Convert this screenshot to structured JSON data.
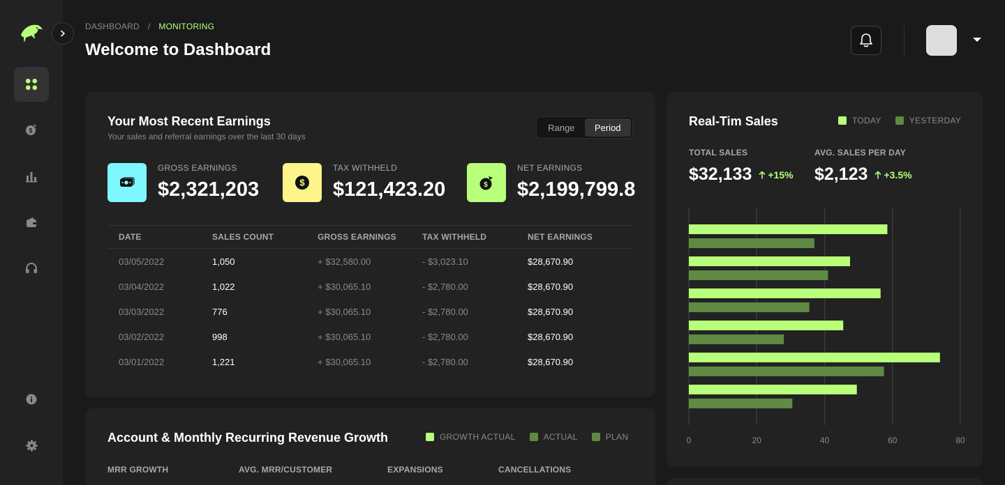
{
  "breadcrumb": {
    "root": "DASHBOARD",
    "separator": "/",
    "current": "MONITORING"
  },
  "page_title": "Welcome to Dashboard",
  "colors": {
    "accent": "#b8ff7a",
    "accent_dark": "#5f8a44",
    "cyan": "#7ff7ff",
    "yellow": "#fdf58a",
    "green": "#b8ff7a"
  },
  "sidebar": {
    "items": [
      {
        "icon": "dashboard-grid-icon",
        "active": true
      },
      {
        "icon": "money-bag-icon",
        "active": false
      },
      {
        "icon": "bar-chart-icon",
        "active": false
      },
      {
        "icon": "wallet-icon",
        "active": false
      },
      {
        "icon": "headphones-icon",
        "active": false
      },
      {
        "icon": "info-icon",
        "active": false
      },
      {
        "icon": "gear-icon",
        "active": false
      }
    ]
  },
  "earnings": {
    "title": "Your Most Recent Earnings",
    "subtitle": "Your sales and referral earnings over the last 30 days",
    "toggle": [
      "Range",
      "Period"
    ],
    "toggle_selected": "Period",
    "stats": [
      {
        "label": "GROSS EARNINGS",
        "value": "$2,321,203",
        "icon": "cash-icon"
      },
      {
        "label": "TAX WITHHELD",
        "value": "$121,423.20",
        "icon": "dollar-coin-icon"
      },
      {
        "label": "NET EARNINGS",
        "value": "$2,199,799.8",
        "icon": "money-bag-icon"
      }
    ],
    "table": {
      "headers": [
        "DATE",
        "SALES COUNT",
        "GROSS EARNINGS",
        "TAX WITHHELD",
        "NET EARNINGS"
      ],
      "rows": [
        [
          "03/05/2022",
          "1,050",
          "+ $32,580.00",
          "- $3,023.10",
          "$28,670.90"
        ],
        [
          "03/04/2022",
          "1,022",
          "+ $30,065.10",
          "- $2,780.00",
          "$28,670.90"
        ],
        [
          "03/03/2022",
          "776",
          "+ $30,065.10",
          "- $2,780.00",
          "$28,670.90"
        ],
        [
          "03/02/2022",
          "998",
          "+ $30,065.10",
          "- $2,780.00",
          "$28,670.90"
        ],
        [
          "03/01/2022",
          "1,221",
          "+ $30,065.10",
          "- $2,780.00",
          "$28,670.90"
        ]
      ]
    }
  },
  "mrr": {
    "title": "Account & Monthly Recurring Revenue Growth",
    "legend": [
      "GROWTH ACTUAL",
      "ACTUAL",
      "PLAN"
    ],
    "columns": [
      "MRR GROWTH",
      "AVG. MRR/CUSTOMER",
      "EXPANSIONS",
      "CANCELLATIONS"
    ]
  },
  "sales": {
    "title": "Real-Tim Sales",
    "legend": [
      "TODAY",
      "YESTERDAY"
    ],
    "kpis": [
      {
        "label": "TOTAL SALES",
        "value": "$32,133",
        "delta": "+15%"
      },
      {
        "label": "AVG. SALES PER DAY",
        "value": "$2,123",
        "delta": "+3.5%"
      }
    ]
  },
  "chart_data": {
    "type": "bar",
    "orientation": "horizontal",
    "xlim": [
      0,
      80
    ],
    "x_ticks": [
      "0",
      "20",
      "40",
      "60",
      "80"
    ],
    "grid": true,
    "legend_position": "top-right",
    "series": [
      {
        "name": "TODAY",
        "color": "#b8ff7a",
        "values": [
          58.5,
          47.5,
          56.5,
          45.5,
          74,
          49.5
        ]
      },
      {
        "name": "YESTERDAY",
        "color": "#5f8a44",
        "values": [
          37,
          41,
          35.5,
          28,
          57.5,
          30.5
        ]
      }
    ]
  }
}
